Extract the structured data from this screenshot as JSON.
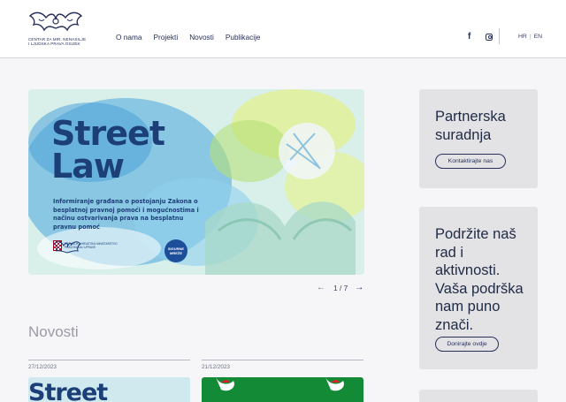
{
  "header": {
    "logo_text": [
      "CENTAR ZA MIR, NENASILJE",
      "I LJUDSKA PRAVA OSIJEK"
    ],
    "nav": [
      "O nama",
      "Projekti",
      "Novosti",
      "Publikacije"
    ],
    "social": {
      "facebook": "facebook-icon",
      "instagram": "instagram-icon"
    },
    "languages": {
      "hr": "HR",
      "separator": "|",
      "en": "EN"
    }
  },
  "hero": {
    "title_line1": "Street",
    "title_line2": "Law",
    "description": "Informiranje građana o postojanju Zakona o besplatnoj pravnoj pomoći i mogućnostima i načinu ostvarivanja prava na besplatnu pravnu pomoć",
    "ministry_text": "REPUBLIKA HRVATSKA MINISTARSTVO PRAVOSUĐA I UPRAVE",
    "badge_text": "SIGURNE MREŽE",
    "slider": {
      "current": 1,
      "total": 7,
      "counter": "1 / 7",
      "prev_icon": "arrow-left-icon",
      "next_icon": "arrow-right-icon"
    }
  },
  "news": {
    "title": "Novosti",
    "items": [
      {
        "date": "27/12/2023",
        "thumb_text": "Street"
      },
      {
        "date": "21/12/2023",
        "thumb_text": ""
      }
    ]
  },
  "sidebar": {
    "cards": [
      {
        "heading": "Partnerska suradnja",
        "button": "Kontaktirajte nas"
      },
      {
        "heading": "Podržite naš rad i aktivnosti. Vaša podrška nam puno znači.",
        "button": "Donirajte ovdje"
      }
    ]
  },
  "colors": {
    "navy": "#26305a",
    "hero_blue": "#1d3f78",
    "card_bg": "#e3e3e6",
    "page_bg": "#f6f6f8"
  }
}
